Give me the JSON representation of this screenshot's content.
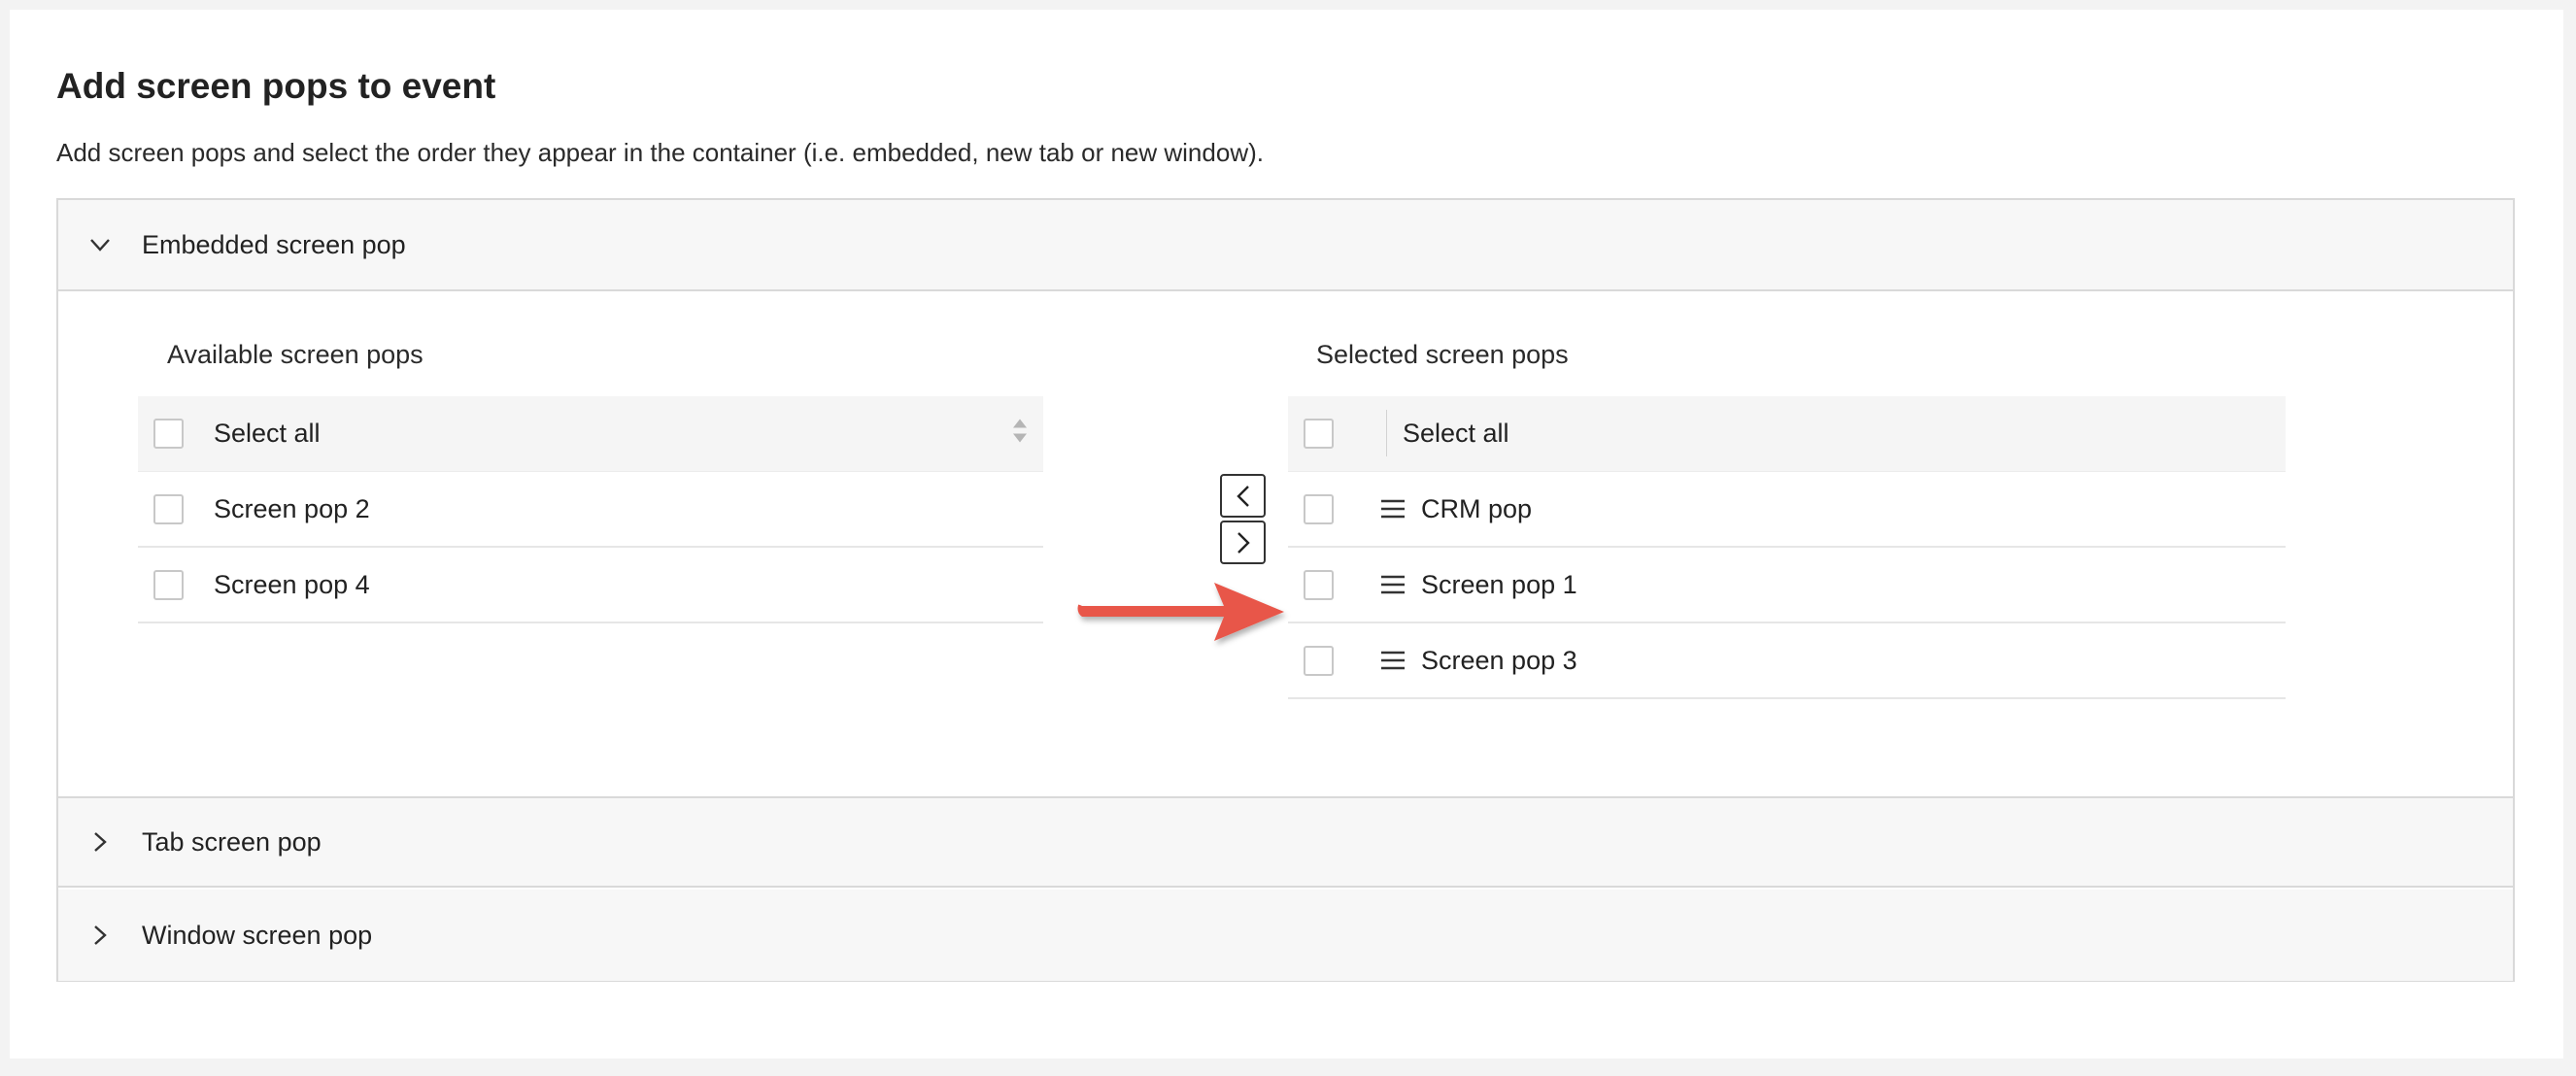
{
  "page": {
    "title": "Add screen pops to event",
    "description": "Add screen pops and select the order they appear in the container (i.e. embedded, new tab or new window)."
  },
  "accordion": {
    "sections": [
      {
        "label": "Embedded screen pop",
        "expanded": true
      },
      {
        "label": "Tab screen pop",
        "expanded": false
      },
      {
        "label": "Window screen pop",
        "expanded": false
      }
    ]
  },
  "available": {
    "title": "Available screen pops",
    "select_all": "Select all",
    "items": [
      "Screen pop 2",
      "Screen pop 4"
    ]
  },
  "selected": {
    "title": "Selected screen pops",
    "select_all": "Select all",
    "items": [
      "CRM pop",
      "Screen pop 1",
      "Screen pop 3"
    ]
  },
  "controls": {
    "move_left_icon": "chevron-left-icon",
    "move_right_icon": "chevron-right-icon"
  },
  "annotation": {
    "arrow_color": "#e8574a"
  }
}
